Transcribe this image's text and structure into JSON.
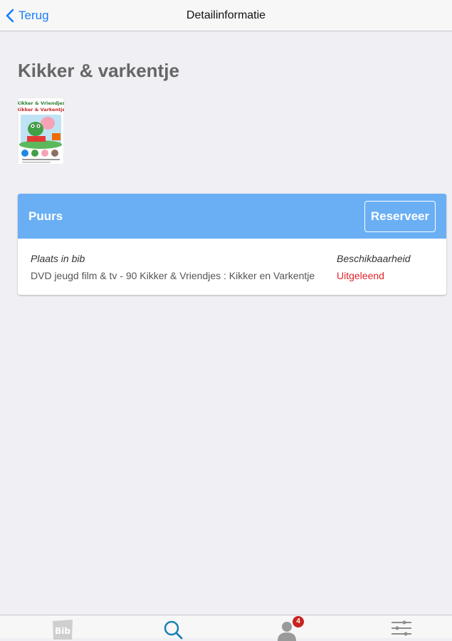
{
  "navbar": {
    "back_label": "Terug",
    "title": "Detailinformatie"
  },
  "item": {
    "title": "Kikker & varkentje",
    "cover": {
      "line1": "Kikker & Vriendjes",
      "line2": "Kikker & Varkentje"
    }
  },
  "availability": {
    "branch": "Puurs",
    "reserve_label": "Reserveer",
    "location_label": "Plaats in bib",
    "location_value": "DVD jeugd film & tv - 90 Kikker & Vriendjes : Kikker en Varkentje",
    "availability_label": "Beschikbaarheid",
    "availability_value": "Uitgeleend",
    "status_color": "#e0262b"
  },
  "tabbar": {
    "tabs": [
      {
        "icon": "bib-logo-icon",
        "label": "Bib"
      },
      {
        "icon": "search-icon"
      },
      {
        "icon": "user-icon",
        "badge": "4"
      },
      {
        "icon": "settings-sliders-icon"
      }
    ]
  },
  "colors": {
    "accent": "#157efb",
    "panel_header": "#6aaff4",
    "background": "#efeff4"
  }
}
